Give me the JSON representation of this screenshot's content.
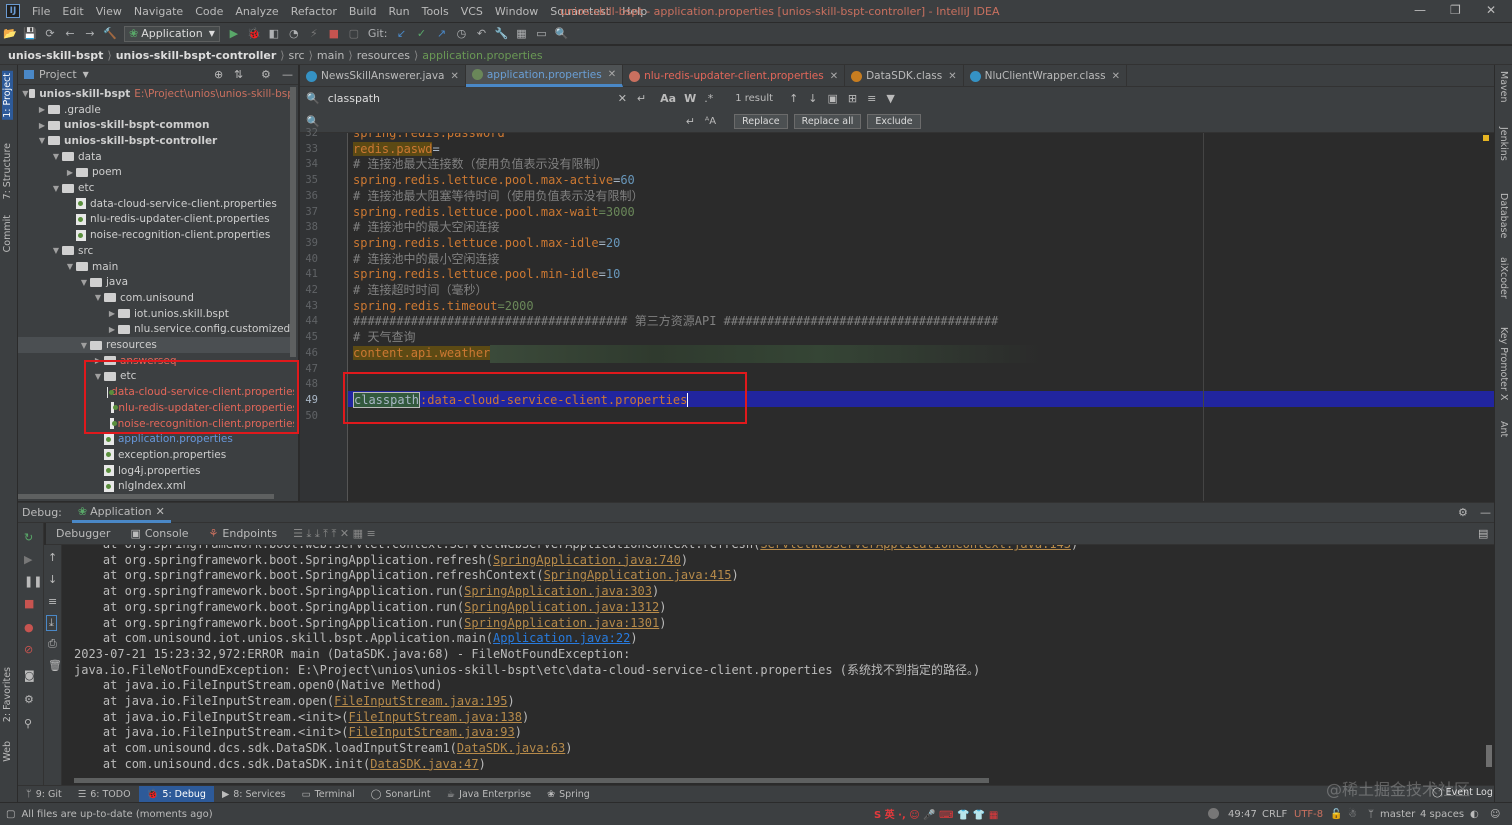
{
  "menubar": {
    "items": [
      "File",
      "Edit",
      "View",
      "Navigate",
      "Code",
      "Analyze",
      "Refactor",
      "Build",
      "Run",
      "Tools",
      "VCS",
      "Window",
      "Squaretest",
      "Help"
    ],
    "title": "unios-skill-bspt - application.properties [unios-skill-bspt-controller] - IntelliJ IDEA"
  },
  "toolbar": {
    "run_config": "Application",
    "git_label": "Git:"
  },
  "breadcrumb": [
    "unios-skill-bspt",
    "unios-skill-bspt-controller",
    "src",
    "main",
    "resources",
    "application.properties"
  ],
  "project_panel": {
    "title": "Project",
    "tree": [
      {
        "indent": 0,
        "arrow": "▼",
        "icon": "folder",
        "label": "unios-skill-bspt",
        "extra": "E:\\Project\\unios\\unios-skill-bspt",
        "bold": true
      },
      {
        "indent": 1,
        "arrow": "▶",
        "icon": "folder",
        "label": ".gradle"
      },
      {
        "indent": 1,
        "arrow": "▶",
        "icon": "folder",
        "label": "unios-skill-bspt-common",
        "bold": true
      },
      {
        "indent": 1,
        "arrow": "▼",
        "icon": "folder",
        "label": "unios-skill-bspt-controller",
        "bold": true
      },
      {
        "indent": 2,
        "arrow": "▼",
        "icon": "folder",
        "label": "data"
      },
      {
        "indent": 3,
        "arrow": "▶",
        "icon": "folder",
        "label": "poem"
      },
      {
        "indent": 2,
        "arrow": "▼",
        "icon": "folder",
        "label": "etc"
      },
      {
        "indent": 3,
        "arrow": "",
        "icon": "prop",
        "label": "data-cloud-service-client.properties"
      },
      {
        "indent": 3,
        "arrow": "",
        "icon": "prop",
        "label": "nlu-redis-updater-client.properties"
      },
      {
        "indent": 3,
        "arrow": "",
        "icon": "prop",
        "label": "noise-recognition-client.properties"
      },
      {
        "indent": 2,
        "arrow": "▼",
        "icon": "folder",
        "label": "src"
      },
      {
        "indent": 3,
        "arrow": "▼",
        "icon": "folder",
        "label": "main"
      },
      {
        "indent": 4,
        "arrow": "▼",
        "icon": "folder",
        "label": "java"
      },
      {
        "indent": 5,
        "arrow": "▼",
        "icon": "folder",
        "label": "com.unisound"
      },
      {
        "indent": 6,
        "arrow": "▶",
        "icon": "folder",
        "label": "iot.unios.skill.bspt"
      },
      {
        "indent": 6,
        "arrow": "▶",
        "icon": "folder",
        "label": "nlu.service.config.customized"
      },
      {
        "indent": 4,
        "arrow": "▼",
        "icon": "folder",
        "label": "resources",
        "selected": true
      },
      {
        "indent": 5,
        "arrow": "▶",
        "icon": "folder",
        "label": "answerseq",
        "red": true
      },
      {
        "indent": 5,
        "arrow": "▼",
        "icon": "folder",
        "label": "etc"
      },
      {
        "indent": 6,
        "arrow": "",
        "icon": "prop",
        "label": "data-cloud-service-client.properties",
        "red": true
      },
      {
        "indent": 6,
        "arrow": "",
        "icon": "prop",
        "label": "nlu-redis-updater-client.properties",
        "red": true
      },
      {
        "indent": 6,
        "arrow": "",
        "icon": "prop",
        "label": "noise-recognition-client.properties",
        "red": true
      },
      {
        "indent": 5,
        "arrow": "",
        "icon": "prop",
        "label": "application.properties",
        "blue": true
      },
      {
        "indent": 5,
        "arrow": "",
        "icon": "prop",
        "label": "exception.properties"
      },
      {
        "indent": 5,
        "arrow": "",
        "icon": "prop",
        "label": "log4j.properties"
      },
      {
        "indent": 5,
        "arrow": "",
        "icon": "prop",
        "label": "nlgIndex.xml"
      }
    ]
  },
  "editor_tabs": [
    {
      "label": "NewsSkillAnswerer.java",
      "color": "#3592c4"
    },
    {
      "label": "application.properties",
      "color": "#6a8759",
      "active": true
    },
    {
      "label": "nlu-redis-updater-client.properties",
      "color": "#c9705f",
      "red": true
    },
    {
      "label": "DataSDK.class",
      "color": "#c77d20"
    },
    {
      "label": "NluClientWrapper.class",
      "color": "#3592c4"
    }
  ],
  "find": {
    "search_value": "classpath",
    "result_count": "1 result",
    "replace_label": "Replace",
    "replace_all_label": "Replace all",
    "exclude_label": "Exclude",
    "match_case": "Aa",
    "words": "W"
  },
  "code_lines": [
    {
      "n": "32",
      "parts": [
        {
          "t": "spring.redis.password",
          "c": "k"
        }
      ]
    },
    {
      "n": "33",
      "parts": [
        {
          "t": "redis.paswd",
          "c": "k"
        },
        {
          "t": "=",
          "c": "w"
        }
      ]
    },
    {
      "n": "34",
      "parts": [
        {
          "t": "# 连接池最大连接数（使用负值表示没有限制）",
          "c": "cm"
        }
      ]
    },
    {
      "n": "35",
      "parts": [
        {
          "t": "spring.redis.lettuce.pool.max-active",
          "c": "k"
        },
        {
          "t": "=",
          "c": "w"
        },
        {
          "t": "60",
          "c": "n"
        }
      ]
    },
    {
      "n": "36",
      "parts": [
        {
          "t": "# 连接池最大阻塞等待时间（使用负值表示没有限制）",
          "c": "cm"
        }
      ]
    },
    {
      "n": "37",
      "parts": [
        {
          "t": "spring.redis.lettuce.pool.max-wait",
          "c": "k"
        },
        {
          "t": "=3000",
          "c": "s"
        }
      ]
    },
    {
      "n": "38",
      "parts": [
        {
          "t": "# 连接池中的最大空闲连接",
          "c": "cm"
        }
      ]
    },
    {
      "n": "39",
      "parts": [
        {
          "t": "spring.redis.lettuce.pool.max-idle",
          "c": "k"
        },
        {
          "t": "=",
          "c": "w"
        },
        {
          "t": "20",
          "c": "n"
        }
      ]
    },
    {
      "n": "40",
      "parts": [
        {
          "t": "# 连接池中的最小空闲连接",
          "c": "cm"
        }
      ]
    },
    {
      "n": "41",
      "parts": [
        {
          "t": "spring.redis.lettuce.pool.min-idle",
          "c": "k"
        },
        {
          "t": "=",
          "c": "w"
        },
        {
          "t": "10",
          "c": "n"
        }
      ]
    },
    {
      "n": "42",
      "parts": [
        {
          "t": "# 连接超时时间（毫秒）",
          "c": "cm"
        }
      ]
    },
    {
      "n": "43",
      "parts": [
        {
          "t": "spring.redis.timeout",
          "c": "k"
        },
        {
          "t": "=2000",
          "c": "s"
        }
      ]
    },
    {
      "n": "44",
      "parts": [
        {
          "t": "###################################### 第三方资源API ######################################",
          "c": "cm"
        }
      ]
    },
    {
      "n": "45",
      "parts": [
        {
          "t": "# 天气查询",
          "c": "cm"
        }
      ]
    },
    {
      "n": "46",
      "parts": [
        {
          "t": "content.api.weather",
          "c": "k"
        }
      ]
    },
    {
      "n": "47",
      "parts": []
    },
    {
      "n": "48",
      "parts": []
    },
    {
      "n": "49",
      "parts": [
        {
          "t": "classpath",
          "c": "w"
        },
        {
          "t": ":data-cloud-service-client.properties",
          "c": "k"
        }
      ]
    },
    {
      "n": "50",
      "parts": []
    }
  ],
  "debug": {
    "label": "Debug:",
    "app_tab": "Application",
    "tabs": [
      "Debugger",
      "Console",
      "Endpoints"
    ],
    "console": [
      [
        {
          "t": "    at org.springframework.boot.web.servlet.context.ServletWebServerApplicationContext.refresh("
        },
        {
          "t": "ServletWebServerApplicationContext.java:143",
          "l": "o"
        },
        {
          "t": ")"
        }
      ],
      [
        {
          "t": "    at org.springframework.boot.SpringApplication.refresh("
        },
        {
          "t": "SpringApplication.java:740",
          "l": "o"
        },
        {
          "t": ")"
        }
      ],
      [
        {
          "t": "    at org.springframework.boot.SpringApplication.refreshContext("
        },
        {
          "t": "SpringApplication.java:415",
          "l": "o"
        },
        {
          "t": ")"
        }
      ],
      [
        {
          "t": "    at org.springframework.boot.SpringApplication.run("
        },
        {
          "t": "SpringApplication.java:303",
          "l": "o"
        },
        {
          "t": ")"
        }
      ],
      [
        {
          "t": "    at org.springframework.boot.SpringApplication.run("
        },
        {
          "t": "SpringApplication.java:1312",
          "l": "o"
        },
        {
          "t": ")"
        }
      ],
      [
        {
          "t": "    at org.springframework.boot.SpringApplication.run("
        },
        {
          "t": "SpringApplication.java:1301",
          "l": "o"
        },
        {
          "t": ")"
        }
      ],
      [
        {
          "t": "    at com.unisound.iot.unios.skill.bspt.Application.main("
        },
        {
          "t": "Application.java:22",
          "l": "b"
        },
        {
          "t": ")"
        }
      ],
      [
        {
          "t": "2023-07-21 15:23:32,972:ERROR main (DataSDK.java:68) - FileNotFoundException:"
        }
      ],
      [
        {
          "t": "java.io.FileNotFoundException: E:\\Project\\unios\\unios-skill-bspt\\etc\\data-cloud-service-client.properties (系统找不到指定的路径。)"
        }
      ],
      [
        {
          "t": "    at java.io.FileInputStream.open0(Native Method)"
        }
      ],
      [
        {
          "t": "    at java.io.FileInputStream.open("
        },
        {
          "t": "FileInputStream.java:195",
          "l": "o"
        },
        {
          "t": ")"
        }
      ],
      [
        {
          "t": "    at java.io.FileInputStream.<init>("
        },
        {
          "t": "FileInputStream.java:138",
          "l": "o"
        },
        {
          "t": ")"
        }
      ],
      [
        {
          "t": "    at java.io.FileInputStream.<init>("
        },
        {
          "t": "FileInputStream.java:93",
          "l": "o"
        },
        {
          "t": ")"
        }
      ],
      [
        {
          "t": "    at com.unisound.dcs.sdk.DataSDK.loadInputStream1("
        },
        {
          "t": "DataSDK.java:63",
          "l": "o"
        },
        {
          "t": ")"
        }
      ],
      [
        {
          "t": "    at com.unisound.dcs.sdk.DataSDK.init("
        },
        {
          "t": "DataSDK.java:47",
          "l": "o"
        },
        {
          "t": ")"
        }
      ]
    ]
  },
  "bottom_tabs": [
    "9: Git",
    "6: TODO",
    "5: Debug",
    "8: Services",
    "Terminal",
    "SonarLint",
    "Java Enterprise",
    "Spring"
  ],
  "status": {
    "message": "All files are up-to-date (moments ago)",
    "position": "49:47",
    "line_sep": "CRLF",
    "encoding": "UTF-8",
    "branch": "master",
    "indent": "4 spaces",
    "event_log": "Event Log",
    "watermark": "@稀土掘金技术社区"
  },
  "left_tool_tabs": [
    "1: Project",
    "7: Structure",
    "Commit",
    "2: Favorites",
    "Web"
  ],
  "right_tool_tabs": [
    "Maven",
    "Jenkins",
    "Database",
    "aiXcoder",
    "Key Promoter X",
    "Ant"
  ]
}
